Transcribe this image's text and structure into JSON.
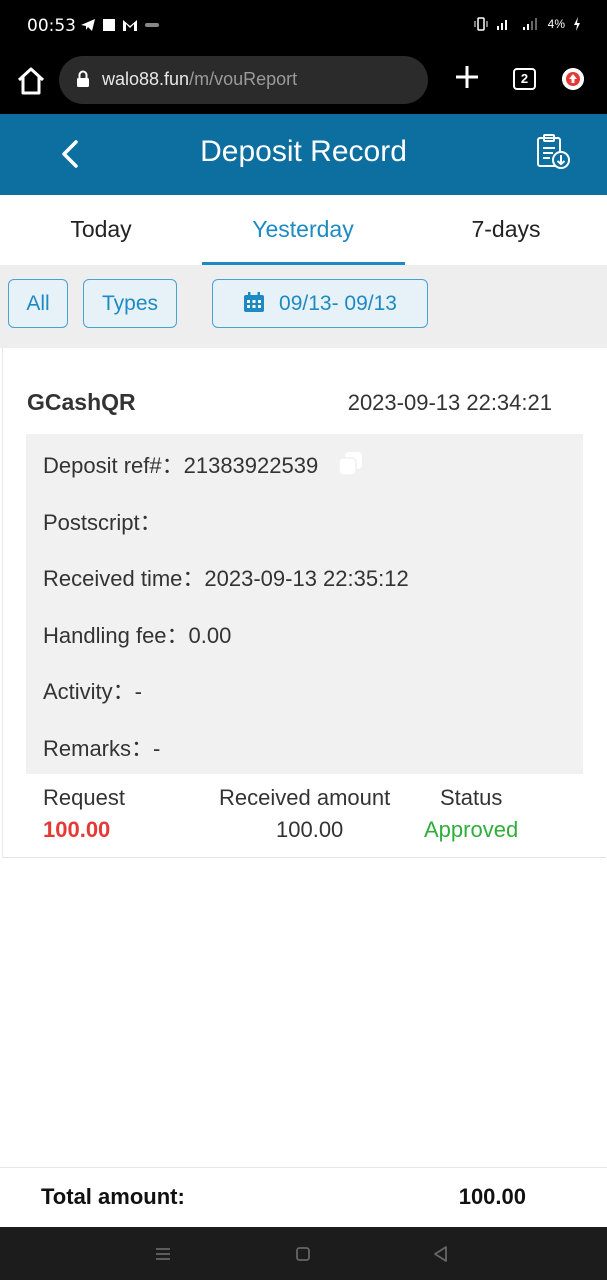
{
  "status_bar": {
    "time": "00:53",
    "battery": "4%"
  },
  "browser": {
    "url_host": "walo88.fun",
    "url_path": "/m/vouReport",
    "tab_count": "2"
  },
  "header": {
    "title": "Deposit Record"
  },
  "tabs": [
    {
      "label": "Today",
      "active": false
    },
    {
      "label": "Yesterday",
      "active": true
    },
    {
      "label": "7-days",
      "active": false
    }
  ],
  "filters": {
    "all_label": "All",
    "types_label": "Types",
    "date_range": "09/13- 09/13"
  },
  "record": {
    "name": "GCashQR",
    "datetime": "2023-09-13 22:34:21",
    "deposit_ref": "Deposit ref#：21383922539",
    "postscript": "Postscript：",
    "received_time": "Received time：2023-09-13 22:35:12",
    "handling_fee": "Handling fee：0.00",
    "activity": "Activity：-",
    "remarks": "Remarks：-",
    "request_label": "Request",
    "received_amount_label": "Received amount",
    "status_label": "Status",
    "request_value": "100.00",
    "received_amount_value": "100.00",
    "status_value": "Approved"
  },
  "footer": {
    "total_label": "Total amount:",
    "total_value": "100.00"
  },
  "colors": {
    "header_bg": "#0d6ea0",
    "accent": "#1e8ac3",
    "request_red": "#e53935",
    "approved_green": "#2fae3c"
  }
}
